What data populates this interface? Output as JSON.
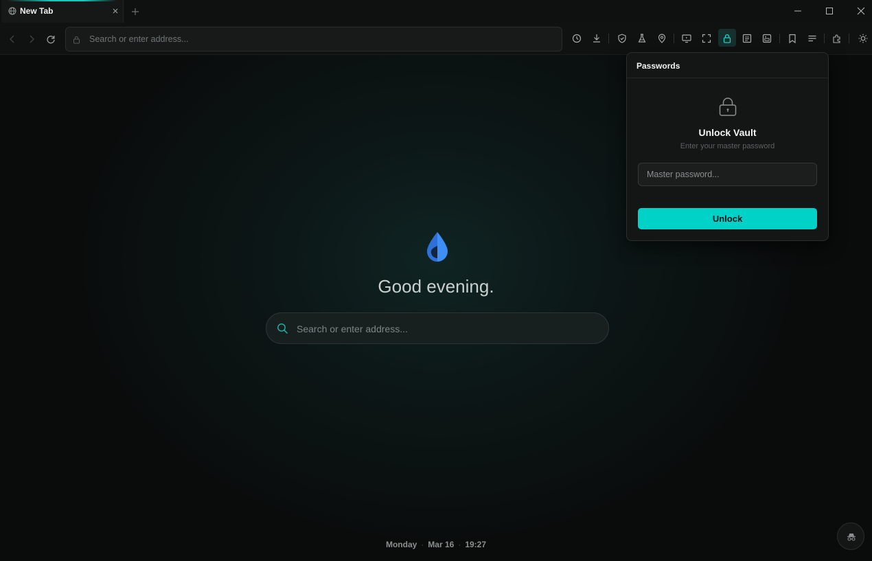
{
  "window": {
    "tab_title": "New Tab",
    "icons": {
      "tab_favicon": "globe-icon",
      "tab_close": "close-icon",
      "new_tab": "plus-icon",
      "minimize": "minimize-icon",
      "maximize": "maximize-icon",
      "close": "close-icon"
    }
  },
  "toolbar": {
    "address_placeholder": "Search or enter address...",
    "icons": [
      "back-icon",
      "forward-icon",
      "reload-icon",
      "lock-icon",
      "history-icon",
      "download-icon",
      "shield-icon",
      "flask-icon",
      "location-pin-icon",
      "screen-cast-icon",
      "fullscreen-icon",
      "password-lock-icon",
      "reader-icon",
      "media-icon",
      "bookmark-icon",
      "menu-icon",
      "extensions-icon",
      "theme-sun-icon"
    ],
    "active_icon": "password-lock-icon"
  },
  "newtab": {
    "greeting": "Good evening.",
    "search_placeholder": "Search or enter address...",
    "date": {
      "day": "Monday",
      "date": "Mar 16",
      "time": "19:27",
      "separator": "·"
    }
  },
  "passwords_popup": {
    "title": "Passwords",
    "heading": "Unlock Vault",
    "subtitle": "Enter your master password",
    "input_placeholder": "Master password...",
    "input_value": "",
    "button_label": "Unlock"
  },
  "colors": {
    "accent": "#00d2c8",
    "background": "#0b0c0c",
    "drop_blue": "#3a8ff5"
  }
}
